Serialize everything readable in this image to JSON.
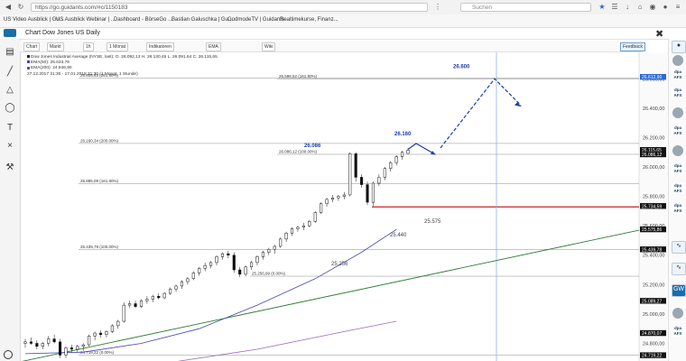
{
  "browser": {
    "url": "https://go.guidants.com/#c/1150183",
    "search_placeholder": "Suchen",
    "bookmarks": [
      "US Video Ausblick | Gu...",
      "US Ausblick Webinar | ...",
      "Dashboard - BörseGo ...",
      "Bastian Galuschka | Gu...",
      "GodmodeTV | Guidants",
      "Realtimekurse, Finanz..."
    ]
  },
  "app": {
    "chart_title": "Chart Dow Jones US Daily",
    "feedback_label": "Feedback"
  },
  "toolbar": {
    "chart_label": "Chart",
    "market_label": "Markt",
    "interval_label": "1h",
    "period_label": "1 Monat",
    "indicators_label": "Indikatoren",
    "ema_label": "EMA",
    "wiki_label": "Wiki"
  },
  "legend": {
    "instrument_line": "Dow Jones Industrial Average (NYSE, last): O. 26.092,13 H. 26.130,45 L. 26.091,64 C. 26.115,65",
    "ema50_line": "EMA(50): 25.633,78",
    "ema200_line": "EMA(200): 24.846,90",
    "range_line": "27.12.2017 21:30 - 17.01.2018 21:30  (1 Monat, 1 Stunde)"
  },
  "chart_data": {
    "type": "candlestick",
    "y_axis_ticks": [
      26600,
      26400,
      26200,
      26000,
      25800,
      25600,
      25400,
      25200,
      25000,
      24800
    ],
    "y_axis_labels": [
      "26.600,00",
      "26.400,00",
      "26.200,00",
      "26.000,00",
      "25.800,00",
      "25.600,00",
      "25.400,00",
      "25.200,00",
      "25.000,00",
      "24.800,00"
    ],
    "ylim": [
      24680,
      26780
    ],
    "price_markers": [
      {
        "label": "26.612,90",
        "value": 26612.9,
        "color": "#2a6ad3"
      },
      {
        "label": "26.115,65",
        "value": 26115.65,
        "color": "#111111"
      },
      {
        "label": "26.086,12",
        "value": 26086.12,
        "color": "#111111"
      },
      {
        "label": "25.734,59",
        "value": 25734.59,
        "color": "#111111"
      },
      {
        "label": "25.575,86",
        "value": 25575.86,
        "color": "#111111"
      },
      {
        "label": "25.439,78",
        "value": 25439.78,
        "color": "#111111"
      },
      {
        "label": "25.089,27",
        "value": 25089.27,
        "color": "#111111"
      },
      {
        "label": "24.870,07",
        "value": 24870.07,
        "color": "#111111"
      },
      {
        "label": "24.719,22",
        "value": 24719.22,
        "color": "#111111"
      }
    ],
    "fib_lines": [
      {
        "label": "25.605,63 (261.80%)",
        "value": 26605.63
      },
      {
        "label": "26.598,52 (161.80%)",
        "value": 26598.52
      },
      {
        "label": "26.160,34 (200.00%)",
        "value": 26160.34
      },
      {
        "label": "26.086,12 (100.00%)",
        "value": 26086.12
      },
      {
        "label": "25.885,09 (161.80%)",
        "value": 25885.09
      },
      {
        "label": "25.439,78 (100.00%)",
        "value": 25439.78
      },
      {
        "label": "25.256,99 (0.00%)",
        "value": 25256.99
      },
      {
        "label": "24.719,22 (0.00%)",
        "value": 24719.22
      }
    ],
    "annotations": [
      {
        "text": "26.600",
        "value": 26600
      },
      {
        "text": "26.160",
        "value": 26160
      },
      {
        "text": "26.086",
        "value": 26086
      },
      {
        "text": "25.575",
        "value": 25575
      },
      {
        "text": "25.440",
        "value": 25440
      },
      {
        "text": "25.256",
        "value": 25256
      }
    ],
    "candles": [
      [
        24800,
        24830,
        24770,
        24810
      ],
      [
        24810,
        24840,
        24790,
        24800
      ],
      [
        24800,
        24820,
        24760,
        24780
      ],
      [
        24780,
        24810,
        24760,
        24800
      ],
      [
        24800,
        24850,
        24780,
        24830
      ],
      [
        24830,
        24860,
        24800,
        24810
      ],
      [
        24810,
        24830,
        24700,
        24720
      ],
      [
        24720,
        24780,
        24700,
        24770
      ],
      [
        24770,
        24790,
        24740,
        24760
      ],
      [
        24760,
        24790,
        24740,
        24780
      ],
      [
        24780,
        24800,
        24750,
        24790
      ],
      [
        24790,
        24860,
        24780,
        24850
      ],
      [
        24850,
        24880,
        24820,
        24870
      ],
      [
        24870,
        24890,
        24840,
        24860
      ],
      [
        24860,
        24890,
        24840,
        24880
      ],
      [
        24880,
        24930,
        24870,
        24920
      ],
      [
        24920,
        24960,
        24900,
        24950
      ],
      [
        24950,
        25080,
        24940,
        25060
      ],
      [
        25060,
        25090,
        25040,
        25070
      ],
      [
        25070,
        25090,
        25040,
        25050
      ],
      [
        25050,
        25100,
        25040,
        25090
      ],
      [
        25090,
        25120,
        25070,
        25100
      ],
      [
        25100,
        25130,
        25080,
        25120
      ],
      [
        25120,
        25140,
        25100,
        25110
      ],
      [
        25110,
        25150,
        25100,
        25140
      ],
      [
        25140,
        25180,
        25130,
        25170
      ],
      [
        25170,
        25200,
        25150,
        25190
      ],
      [
        25190,
        25230,
        25170,
        25220
      ],
      [
        25220,
        25250,
        25200,
        25240
      ],
      [
        25240,
        25290,
        25230,
        25280
      ],
      [
        25280,
        25320,
        25260,
        25310
      ],
      [
        25310,
        25350,
        25290,
        25330
      ],
      [
        25330,
        25360,
        25310,
        25350
      ],
      [
        25350,
        25400,
        25330,
        25390
      ],
      [
        25390,
        25420,
        25370,
        25410
      ],
      [
        25410,
        25430,
        25380,
        25400
      ],
      [
        25400,
        25420,
        25280,
        25300
      ],
      [
        25300,
        25320,
        25250,
        25270
      ],
      [
        25270,
        25330,
        25256,
        25320
      ],
      [
        25320,
        25360,
        25300,
        25350
      ],
      [
        25350,
        25400,
        25330,
        25390
      ],
      [
        25390,
        25430,
        25370,
        25420
      ],
      [
        25420,
        25450,
        25400,
        25440
      ],
      [
        25440,
        25470,
        25410,
        25460
      ],
      [
        25460,
        25520,
        25450,
        25510
      ],
      [
        25510,
        25560,
        25490,
        25550
      ],
      [
        25550,
        25590,
        25530,
        25580
      ],
      [
        25580,
        25600,
        25560,
        25590
      ],
      [
        25590,
        25620,
        25570,
        25600
      ],
      [
        25600,
        25640,
        25590,
        25630
      ],
      [
        25630,
        25700,
        25620,
        25690
      ],
      [
        25690,
        25760,
        25680,
        25750
      ],
      [
        25750,
        25790,
        25730,
        25780
      ],
      [
        25780,
        25810,
        25760,
        25790
      ],
      [
        25790,
        25810,
        25770,
        25800
      ],
      [
        25800,
        25830,
        25780,
        25810
      ],
      [
        25810,
        26100,
        25800,
        26090
      ],
      [
        26090,
        26100,
        25900,
        25930
      ],
      [
        25930,
        25950,
        25860,
        25880
      ],
      [
        25880,
        25900,
        25740,
        25760
      ],
      [
        25760,
        25900,
        25734,
        25890
      ],
      [
        25890,
        25950,
        25870,
        25930
      ],
      [
        25930,
        26000,
        25910,
        25990
      ],
      [
        25990,
        26040,
        25970,
        26030
      ],
      [
        26030,
        26080,
        26010,
        26070
      ],
      [
        26070,
        26110,
        26050,
        26100
      ],
      [
        26092,
        26130,
        26091,
        26115
      ]
    ],
    "ema50": [
      [
        0,
        24730
      ],
      [
        10,
        24740
      ],
      [
        20,
        24800
      ],
      [
        30,
        24900
      ],
      [
        40,
        25060
      ],
      [
        50,
        25240
      ],
      [
        58,
        25420
      ],
      [
        64,
        25575
      ]
    ],
    "ema200": [
      [
        0,
        24560
      ],
      [
        20,
        24640
      ],
      [
        40,
        24760
      ],
      [
        55,
        24880
      ],
      [
        64,
        24950
      ]
    ],
    "trend_green": [
      [
        -5,
        24640
      ],
      [
        92,
        25570
      ]
    ]
  }
}
